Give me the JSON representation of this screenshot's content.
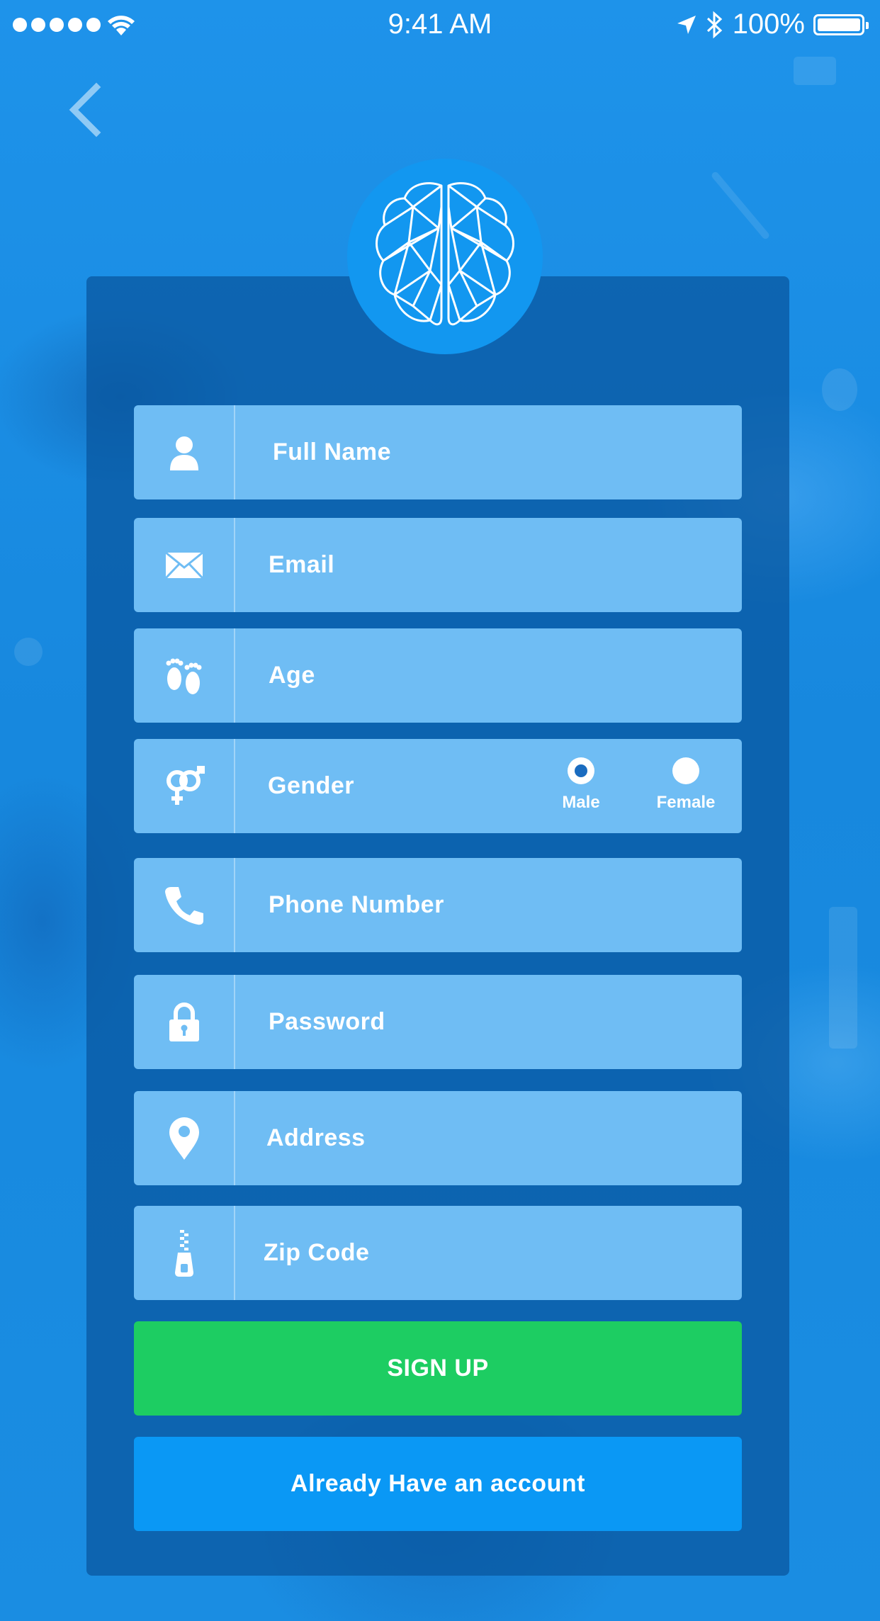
{
  "status_bar": {
    "time": "9:41 AM",
    "battery": "100%"
  },
  "form": {
    "fields": [
      {
        "label": "Full Name",
        "icon": "person-icon"
      },
      {
        "label": "Email",
        "icon": "envelope-icon"
      },
      {
        "label": "Age",
        "icon": "footprints-icon"
      },
      {
        "label": "Gender",
        "icon": "gender-icon"
      },
      {
        "label": "Phone Number",
        "icon": "phone-icon"
      },
      {
        "label": "Password",
        "icon": "lock-icon"
      },
      {
        "label": "Address",
        "icon": "location-pin-icon"
      },
      {
        "label": "Zip Code",
        "icon": "zipper-icon"
      }
    ],
    "gender_options": [
      {
        "label": "Male",
        "selected": true
      },
      {
        "label": "Female",
        "selected": false
      }
    ]
  },
  "buttons": {
    "signup": "SIGN UP",
    "login": "Already Have an account"
  },
  "colors": {
    "background": "#1b8fe6",
    "panel": "#08549c",
    "field": "#6fbdf4",
    "signup": "#1dcd62",
    "login": "#0a98f5",
    "logo": "#1297f0"
  }
}
